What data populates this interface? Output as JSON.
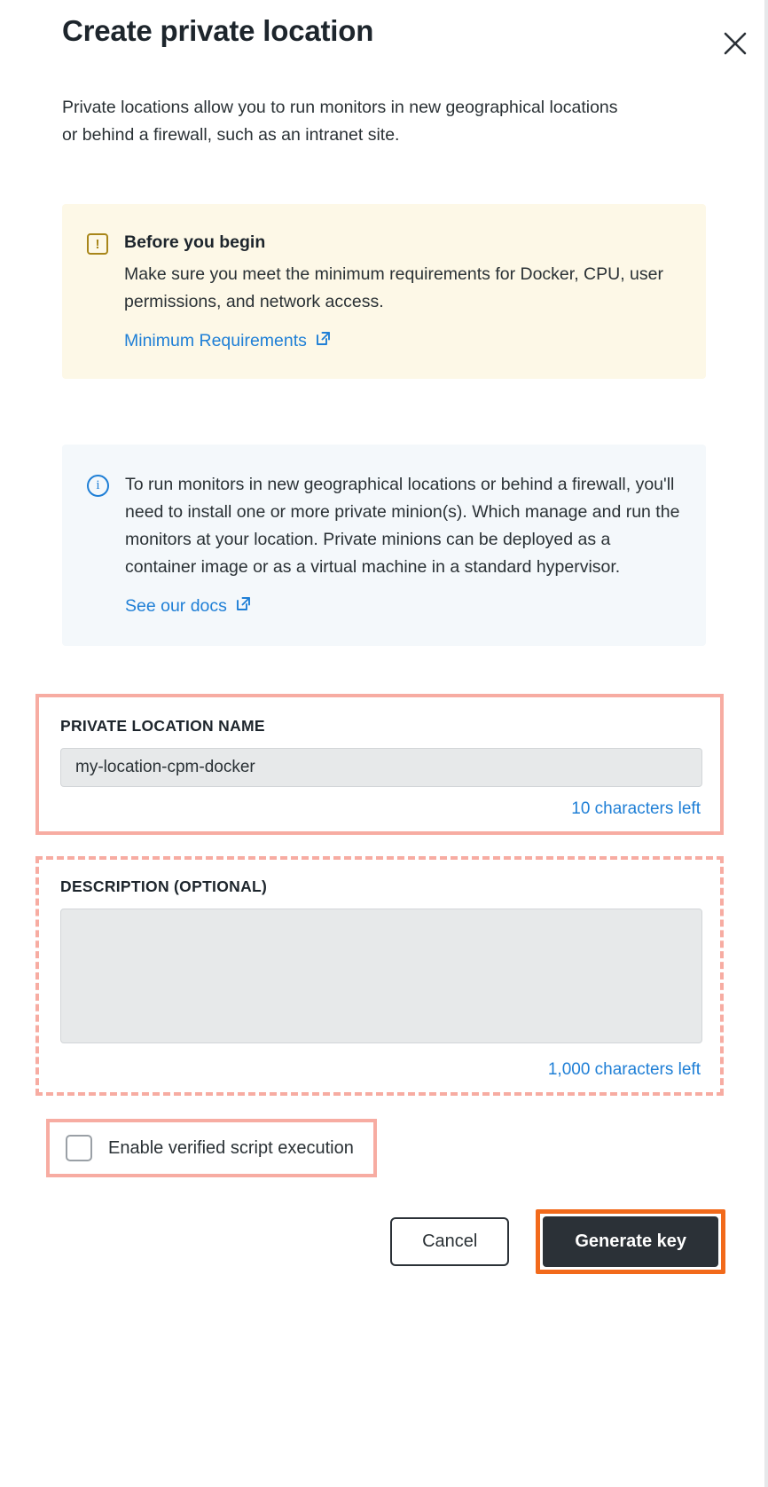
{
  "modal": {
    "title": "Create private location",
    "close_icon": "close-icon",
    "intro": "Private locations allow you to run monitors in new geographical locations or behind a firewall, such as an intranet site."
  },
  "warning_callout": {
    "icon": "warning-exclamation-icon",
    "icon_glyph": "!",
    "title": "Before you begin",
    "text": "Make sure you meet the minimum requirements for Docker, CPU, user permissions, and network access.",
    "link_label": "Minimum Requirements",
    "link_icon": "external-link-icon",
    "bg_color": "#fdf8e7",
    "icon_color": "#a8861a"
  },
  "info_callout": {
    "icon": "info-circle-icon",
    "icon_glyph": "i",
    "text": "To run monitors in new geographical locations or behind a firewall, you'll need to install one or more private minion(s). Which manage and run the monitors at your location. Private minions can be deployed as a container image or as a virtual machine in a standard hypervisor.",
    "link_label": "See our docs",
    "link_icon": "external-link-icon",
    "bg_color": "#f4f8fb",
    "icon_color": "#1f7fd6"
  },
  "name_field": {
    "label": "PRIVATE LOCATION NAME",
    "value": "my-location-cpm-docker",
    "placeholder": "",
    "counter": "10 characters left",
    "counter_color": "#1f7fd6",
    "highlight_color": "#f7aca2",
    "highlight_style": "solid"
  },
  "description_field": {
    "label": "DESCRIPTION (OPTIONAL)",
    "value": "",
    "placeholder": "",
    "counter": "1,000 characters left",
    "counter_color": "#1f7fd6",
    "highlight_color": "#f7aca2",
    "highlight_style": "dashed"
  },
  "verified_script": {
    "label": "Enable verified script execution",
    "checked": false,
    "highlight_color": "#f7aca2",
    "highlight_style": "solid"
  },
  "footer": {
    "cancel_label": "Cancel",
    "primary_label": "Generate key",
    "primary_bg": "#2b3137",
    "primary_highlight_color": "#f26a1b"
  }
}
